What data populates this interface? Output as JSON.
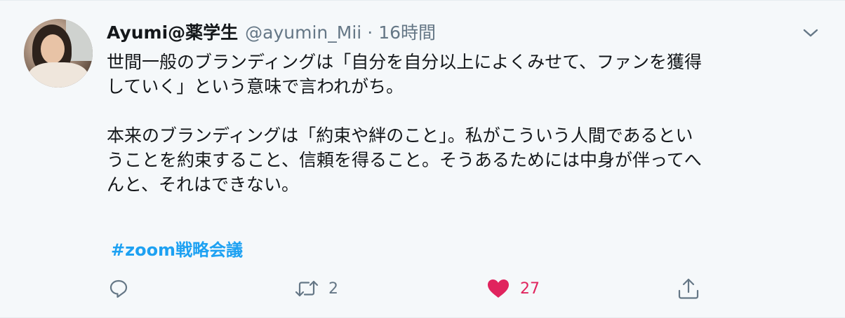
{
  "tweet": {
    "author_name": "Ayumi@薬学生",
    "author_handle": "@ayumin_Mii",
    "separator": "·",
    "timestamp": "16時間",
    "text_lines": [
      "世間一般のブランディングは「自分を自分以上によくみせて、ファンを獲得",
      "していく」という意味で言われがち。",
      "",
      "本来のブランディングは「約束や絆のこと」。私がこういう人間であるとい",
      "うことを約束すること、信頼を得ること。そうあるためには中身が伴ってへ",
      "んと、それはできない。"
    ],
    "hashtag": "#zoom戦略会議"
  },
  "actions": {
    "reply_icon": "reply-icon",
    "retweet_icon": "retweet-icon",
    "retweet_count": "2",
    "like_icon": "heart-icon",
    "like_count": "27",
    "share_icon": "share-icon",
    "more_icon": "chevron-down-icon"
  },
  "colors": {
    "background": "#f5f8fa",
    "text": "#14171a",
    "secondary": "#657786",
    "link": "#1da1f2",
    "like": "#e0245e"
  }
}
